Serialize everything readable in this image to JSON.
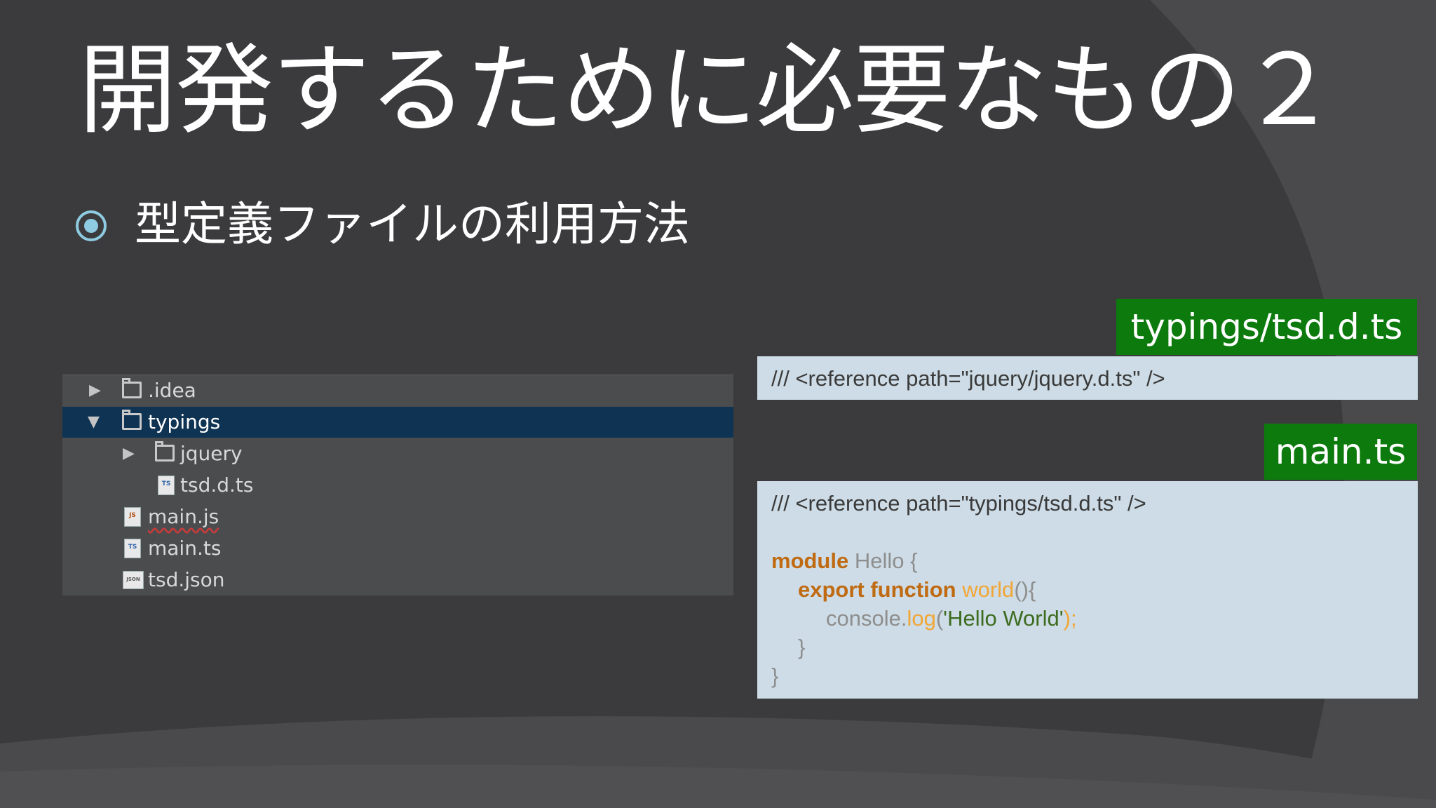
{
  "slide": {
    "title": "開発するために必要なもの２",
    "bullet": "型定義ファイルの利用方法"
  },
  "file_tree": {
    "rows": [
      {
        "label": ".idea",
        "arrow": "▶",
        "icon": "folder-icon"
      },
      {
        "label": "typings",
        "arrow": "▼",
        "icon": "folder-icon",
        "selected": true
      },
      {
        "label": "jquery",
        "arrow": "▶",
        "icon": "folder-icon"
      },
      {
        "label": "tsd.d.ts",
        "arrow": "",
        "icon": "ts-file-icon",
        "badge": "TS"
      },
      {
        "label": "main.js",
        "arrow": "",
        "icon": "js-file-icon",
        "badge": "JS"
      },
      {
        "label": "main.ts",
        "arrow": "",
        "icon": "ts-file-icon",
        "badge": "TS"
      },
      {
        "label": "tsd.json",
        "arrow": "",
        "icon": "json-file-icon",
        "badge": "JSON"
      }
    ]
  },
  "panels": {
    "typings": {
      "tag": "typings/tsd.d.ts",
      "line1": "/// <reference path=\"jquery/jquery.d.ts\" />"
    },
    "main": {
      "tag": "main.ts",
      "ref": "/// <reference path=\"typings/tsd.d.ts\" />",
      "kw_module": "module",
      "module_name": " Hello {",
      "kw_export": "export function",
      "fn_name": " world",
      "fn_tail": "(){",
      "console": "console.",
      "log": "log",
      "paren_open": "(",
      "str": "'Hello World'",
      "paren_close": ");",
      "close_inner": "}",
      "close_outer": "}"
    }
  },
  "colors": {
    "background": "#3b3b3d",
    "tag_green": "#0d7a0d",
    "panel_bg": "#cddce6",
    "tree_selected": "#0f3353"
  }
}
